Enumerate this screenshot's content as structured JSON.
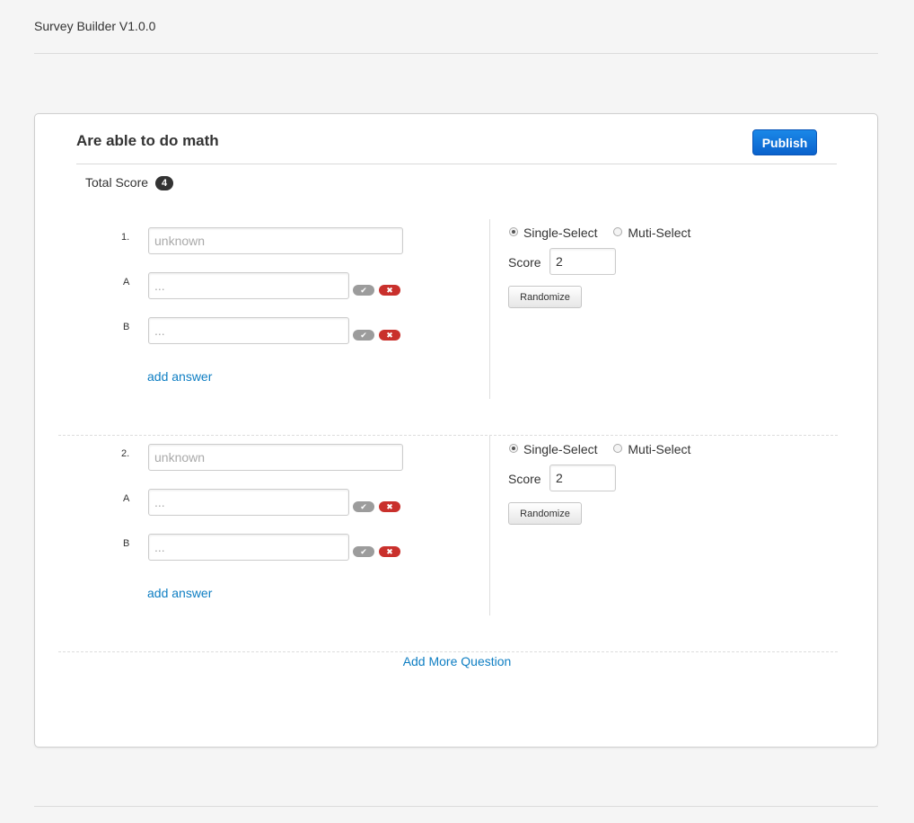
{
  "app": {
    "title": "Survey Builder V1.0.0"
  },
  "survey": {
    "title": "Are able to do math",
    "publish_label": "Publish",
    "total_score_label": "Total Score",
    "total_score_value": "4",
    "add_more_label": "Add More Question"
  },
  "questions": [
    {
      "number": "1.",
      "placeholder": "unknown",
      "options": [
        {
          "letter": "A",
          "placeholder": "..."
        },
        {
          "letter": "B",
          "placeholder": "..."
        }
      ],
      "add_answer_label": "add answer",
      "single_select_label": "Single-Select",
      "multi_select_label": "Muti-Select",
      "selected_mode": "single",
      "score_label": "Score",
      "score_value": "2",
      "randomize_label": "Randomize"
    },
    {
      "number": "2.",
      "placeholder": "unknown",
      "options": [
        {
          "letter": "A",
          "placeholder": "..."
        },
        {
          "letter": "B",
          "placeholder": "..."
        }
      ],
      "add_answer_label": "add answer",
      "single_select_label": "Single-Select",
      "multi_select_label": "Muti-Select",
      "selected_mode": "single",
      "score_label": "Score",
      "score_value": "2",
      "randomize_label": "Randomize"
    }
  ],
  "icons": {
    "check": "check-icon",
    "remove": "remove-icon"
  },
  "colors": {
    "link": "#0e7ec3",
    "publish": "#0a62cc",
    "remove": "#c9302c",
    "check": "#9c9c9c"
  }
}
